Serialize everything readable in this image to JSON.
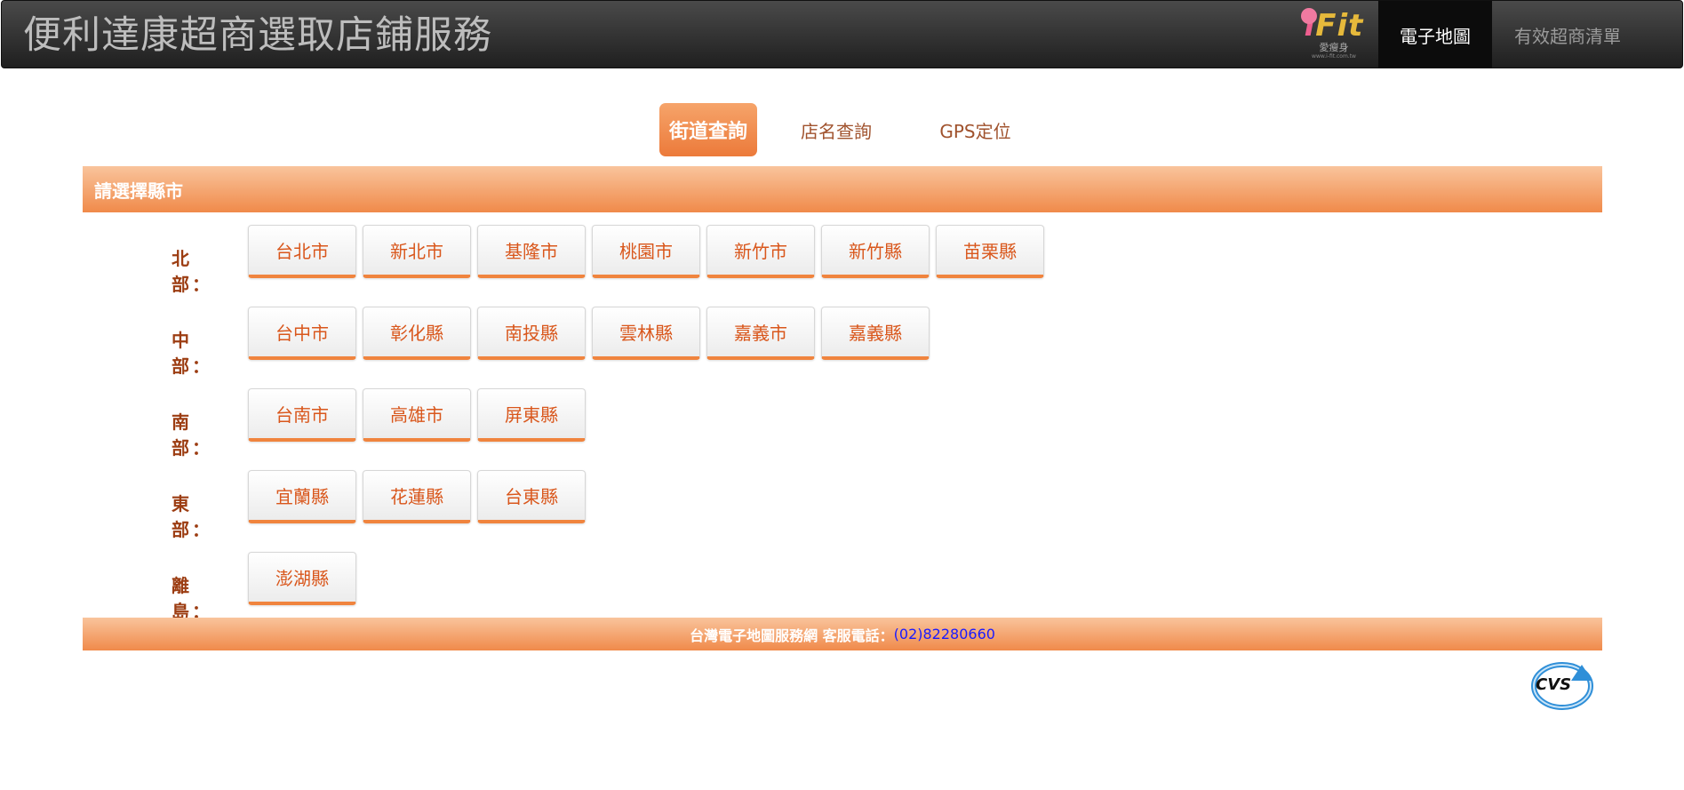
{
  "header": {
    "title": "便利達康超商選取店鋪服務",
    "logo": {
      "word_i": "i",
      "word_f": "F",
      "word_it": "it",
      "subtitle": "愛瘦身",
      "url": "www.i-fit.com.tw"
    },
    "nav": {
      "map_label": "電子地圖",
      "list_label": "有效超商清單"
    }
  },
  "tabs": [
    {
      "label": "街道查詢",
      "active": true
    },
    {
      "label": "店名查詢",
      "active": false
    },
    {
      "label": "GPS定位",
      "active": false
    }
  ],
  "section_title": "請選擇縣市",
  "regions": [
    {
      "label": "北 部：",
      "cities": [
        "台北市",
        "新北市",
        "基隆市",
        "桃園市",
        "新竹市",
        "新竹縣",
        "苗栗縣"
      ]
    },
    {
      "label": "中 部：",
      "cities": [
        "台中市",
        "彰化縣",
        "南投縣",
        "雲林縣",
        "嘉義市",
        "嘉義縣"
      ]
    },
    {
      "label": "南 部：",
      "cities": [
        "台南市",
        "高雄市",
        "屏東縣"
      ]
    },
    {
      "label": "東 部：",
      "cities": [
        "宜蘭縣",
        "花蓮縣",
        "台東縣"
      ]
    },
    {
      "label": "離 島：",
      "cities": [
        "澎湖縣"
      ]
    }
  ],
  "footer": {
    "text": "台灣電子地圖服務網 客服電話：",
    "phone": "(02)82280660",
    "logo_text": "CVS"
  },
  "colors": {
    "accent": "#f08a4a",
    "city_text": "#d9571c",
    "region_label": "#9c3d12",
    "phone": "#1a1aff",
    "header_bg": "#2b2b2b"
  }
}
